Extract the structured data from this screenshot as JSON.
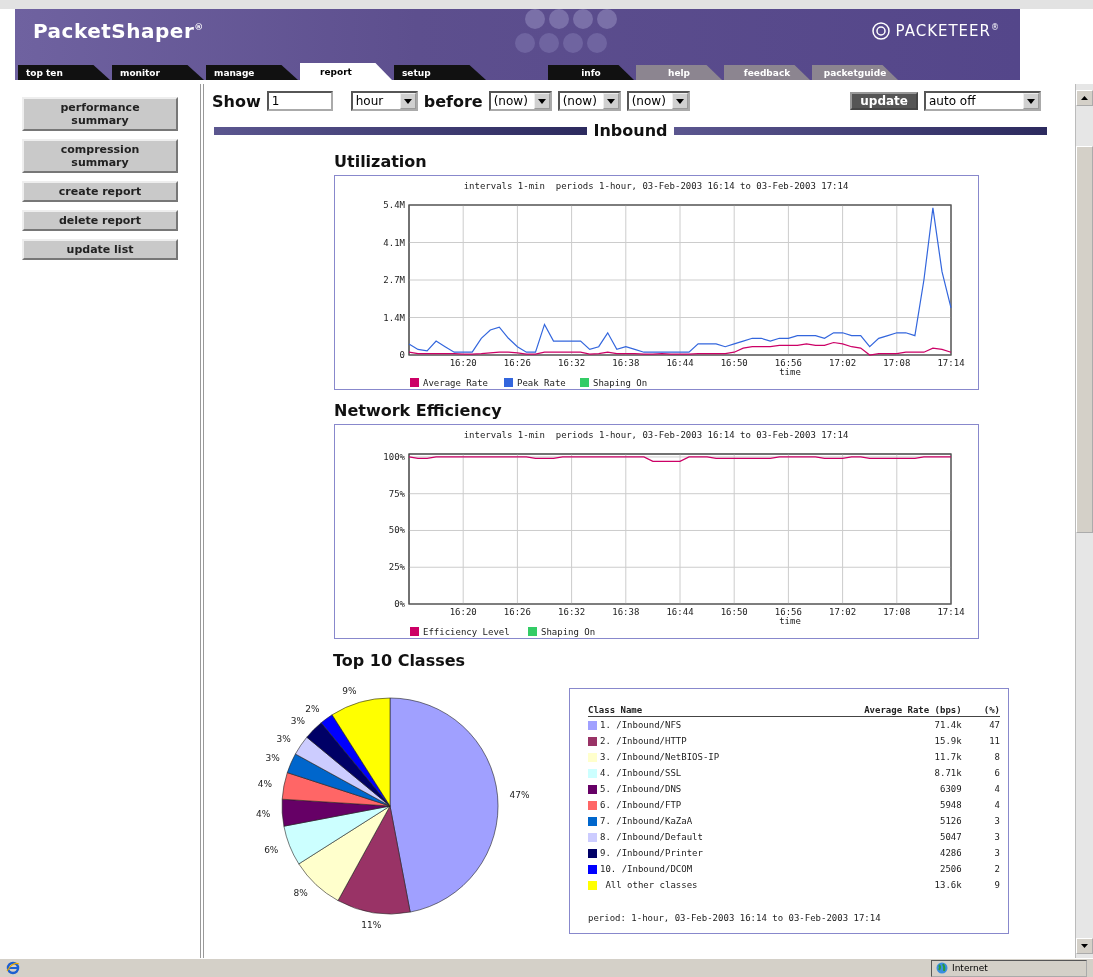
{
  "header": {
    "product": "PacketShaper$^{®}$",
    "brand": "PACKETEER$^{®}$",
    "tabs": [
      {
        "label": "top ten",
        "selected": false
      },
      {
        "label": "monitor",
        "selected": false
      },
      {
        "label": "manage",
        "selected": false
      },
      {
        "label": "report",
        "selected": true
      },
      {
        "label": "setup",
        "selected": false
      }
    ],
    "utility_tabs": [
      {
        "label": "info",
        "kind": "dark"
      },
      {
        "label": "help",
        "kind": "light"
      },
      {
        "label": "feedback",
        "kind": "light"
      },
      {
        "label": "packetguide",
        "kind": "light"
      }
    ]
  },
  "sidebar": {
    "buttons": [
      "performance summary",
      "compression summary",
      "create report",
      "delete report",
      "update list"
    ]
  },
  "controls": {
    "show_label": "Show",
    "count": "1",
    "unit": "hour",
    "before_label": "before",
    "before": [
      "(now)",
      "(now)",
      "(now)"
    ],
    "update": "update",
    "refresh": "auto off"
  },
  "section": {
    "title": "Inbound"
  },
  "utilization": {
    "title": "Utilization",
    "chart_data": {
      "type": "line",
      "title": "intervals 1-min  periods 1-hour, 03-Feb-2003 16:14 to 03-Feb-2003 17:14",
      "xlabel": "time",
      "ylim": [
        0,
        5.4
      ],
      "grid": true,
      "legend": true,
      "categories": [
        null,
        null,
        null,
        null,
        null,
        null,
        "16:20",
        null,
        null,
        null,
        null,
        null,
        "16:26",
        null,
        null,
        null,
        null,
        null,
        "16:32",
        null,
        null,
        null,
        null,
        null,
        "16:38",
        null,
        null,
        null,
        null,
        null,
        "16:44",
        null,
        null,
        null,
        null,
        null,
        "16:50",
        null,
        null,
        null,
        null,
        null,
        "16:56",
        null,
        null,
        null,
        null,
        null,
        "17:02",
        null,
        null,
        null,
        null,
        null,
        "17:08",
        null,
        null,
        null,
        null,
        null,
        "17:14"
      ],
      "yticks": [
        {
          "value": 0,
          "label": "0"
        },
        {
          "value": 1.35,
          "label": "1.4M"
        },
        {
          "value": 2.7,
          "label": "2.7M"
        },
        {
          "value": 4.05,
          "label": "4.1M"
        },
        {
          "value": 5.4,
          "label": "5.4M"
        }
      ],
      "series": [
        {
          "name": "Average Rate",
          "color": "#cc0066",
          "values": [
            0.1,
            0.05,
            0.05,
            0.05,
            0.05,
            0.05,
            0.03,
            0.03,
            0.05,
            0.08,
            0.1,
            0.1,
            0.08,
            0.03,
            0.03,
            0.1,
            0.1,
            0.1,
            0.1,
            0.1,
            0.03,
            0.05,
            0.1,
            0.05,
            0.05,
            0.05,
            0.03,
            0.03,
            0.05,
            0.03,
            0.03,
            0.03,
            0.05,
            0.05,
            0.05,
            0.05,
            0.1,
            0.25,
            0.3,
            0.3,
            0.3,
            0.35,
            0.35,
            0.35,
            0.4,
            0.35,
            0.35,
            0.45,
            0.4,
            0.3,
            0.25,
            0.0,
            0.05,
            0.05,
            0.05,
            0.1,
            0.1,
            0.1,
            0.25,
            0.2,
            0.1
          ]
        },
        {
          "name": "Peak Rate",
          "color": "#3366dd",
          "values": [
            0.4,
            0.2,
            0.15,
            0.5,
            0.3,
            0.1,
            0.1,
            0.1,
            0.6,
            0.9,
            1.0,
            0.6,
            0.3,
            0.1,
            0.1,
            1.1,
            0.5,
            0.5,
            0.5,
            0.5,
            0.2,
            0.3,
            0.8,
            0.2,
            0.3,
            0.2,
            0.1,
            0.1,
            0.1,
            0.1,
            0.1,
            0.1,
            0.4,
            0.4,
            0.4,
            0.3,
            0.4,
            0.5,
            0.6,
            0.6,
            0.5,
            0.6,
            0.6,
            0.7,
            0.7,
            0.7,
            0.6,
            0.8,
            0.8,
            0.7,
            0.7,
            0.3,
            0.6,
            0.7,
            0.8,
            0.8,
            0.7,
            2.7,
            5.3,
            3.0,
            1.7
          ]
        },
        {
          "name": "Shaping On",
          "color": "#33cc66",
          "values": [
            null,
            null,
            null,
            null,
            null,
            null,
            null,
            null,
            null,
            null,
            null,
            null,
            null,
            null,
            null,
            null,
            null,
            null,
            null,
            null,
            null,
            null,
            null,
            null,
            null,
            null,
            null,
            null,
            null,
            null,
            null,
            null,
            null,
            null,
            null,
            null,
            null,
            null,
            null,
            null,
            null,
            null,
            null,
            null,
            null,
            null,
            null,
            null,
            null,
            null,
            null,
            null,
            null,
            null,
            null,
            null,
            null,
            null,
            null,
            null,
            null
          ]
        }
      ]
    }
  },
  "network_efficiency": {
    "title": "Network Efficiency",
    "chart_data": {
      "type": "line",
      "title": "intervals 1-min  periods 1-hour, 03-Feb-2003 16:14 to 03-Feb-2003 17:14",
      "xlabel": "time",
      "ylim": [
        0,
        102
      ],
      "grid": true,
      "legend": true,
      "categories": [
        null,
        null,
        null,
        null,
        null,
        null,
        "16:20",
        null,
        null,
        null,
        null,
        null,
        "16:26",
        null,
        null,
        null,
        null,
        null,
        "16:32",
        null,
        null,
        null,
        null,
        null,
        "16:38",
        null,
        null,
        null,
        null,
        null,
        "16:44",
        null,
        null,
        null,
        null,
        null,
        "16:50",
        null,
        null,
        null,
        null,
        null,
        "16:56",
        null,
        null,
        null,
        null,
        null,
        "17:02",
        null,
        null,
        null,
        null,
        null,
        "17:08",
        null,
        null,
        null,
        null,
        null,
        "17:14"
      ],
      "yticks": [
        {
          "value": 0,
          "label": "0%"
        },
        {
          "value": 25,
          "label": "25%"
        },
        {
          "value": 50,
          "label": "50%"
        },
        {
          "value": 75,
          "label": "75%"
        },
        {
          "value": 100,
          "label": "100%"
        }
      ],
      "series": [
        {
          "name": "Efficiency Level",
          "color": "#cc0066",
          "values": [
            100,
            99,
            99,
            100,
            100,
            100,
            100,
            100,
            100,
            100,
            100,
            100,
            100,
            100,
            99,
            99,
            99,
            100,
            100,
            100,
            100,
            100,
            100,
            100,
            100,
            100,
            100,
            97,
            97,
            97,
            97,
            100,
            100,
            100,
            99,
            99,
            99,
            99,
            99,
            99,
            99,
            100,
            100,
            100,
            100,
            100,
            99,
            99,
            99,
            100,
            100,
            99,
            99,
            99,
            99,
            99,
            99,
            100,
            100,
            100,
            100
          ]
        },
        {
          "name": "Shaping On",
          "color": "#33cc66",
          "values": [
            null,
            null,
            null,
            null,
            null,
            null,
            null,
            null,
            null,
            null,
            null,
            null,
            null,
            null,
            null,
            null,
            null,
            null,
            null,
            null,
            null,
            null,
            null,
            null,
            null,
            null,
            null,
            null,
            null,
            null,
            null,
            null,
            null,
            null,
            null,
            null,
            null,
            null,
            null,
            null,
            null,
            null,
            null,
            null,
            null,
            null,
            null,
            null,
            null,
            null,
            null,
            null,
            null,
            null,
            null,
            null,
            null,
            null,
            null,
            null,
            null
          ]
        }
      ]
    }
  },
  "top_classes": {
    "title": "Top 10 Classes",
    "chart_data": {
      "type": "pie",
      "values": [
        47,
        11,
        8,
        6,
        4,
        4,
        3,
        3,
        3,
        2,
        9
      ],
      "value_labels": [
        "47%",
        "11%",
        "8%",
        "6%",
        "4%",
        "4%",
        "3%",
        "3%",
        "3%",
        "2%",
        "9%"
      ]
    },
    "table": {
      "columns": [
        "Class Name",
        "Average Rate (bps)",
        "(%)"
      ],
      "rows": [
        {
          "color": "#a0a0ff",
          "rank": "1.",
          "name": "/Inbound/NFS",
          "rate": "71.4k",
          "percent": "47"
        },
        {
          "color": "#993366",
          "rank": "2.",
          "name": "/Inbound/HTTP",
          "rate": "15.9k",
          "percent": "11"
        },
        {
          "color": "#ffffcc",
          "rank": "3.",
          "name": "/Inbound/NetBIOS-IP",
          "rate": "11.7k",
          "percent": "8"
        },
        {
          "color": "#ccffff",
          "rank": "4.",
          "name": "/Inbound/SSL",
          "rate": "8.71k",
          "percent": "6"
        },
        {
          "color": "#660066",
          "rank": "5.",
          "name": "/Inbound/DNS",
          "rate": "6309",
          "percent": "4"
        },
        {
          "color": "#ff6666",
          "rank": "6.",
          "name": "/Inbound/FTP",
          "rate": "5948",
          "percent": "4"
        },
        {
          "color": "#0066cc",
          "rank": "7.",
          "name": "/Inbound/KaZaA",
          "rate": "5126",
          "percent": "3"
        },
        {
          "color": "#ccccff",
          "rank": "8.",
          "name": "/Inbound/Default",
          "rate": "5047",
          "percent": "3"
        },
        {
          "color": "#000066",
          "rank": "9.",
          "name": "/Inbound/Printer",
          "rate": "4286",
          "percent": "3"
        },
        {
          "color": "#0000ff",
          "rank": "10.",
          "name": "/Inbound/DCOM",
          "rate": "2506",
          "percent": "2"
        },
        {
          "color": "#ffff00",
          "name": "All other classes",
          "rate": "13.6k",
          "percent": "9"
        }
      ],
      "footer": "period: 1-hour, 03-Feb-2003 16:14 to 03-Feb-2003 17:14"
    }
  },
  "status_bar": {
    "zone": "Internet"
  }
}
